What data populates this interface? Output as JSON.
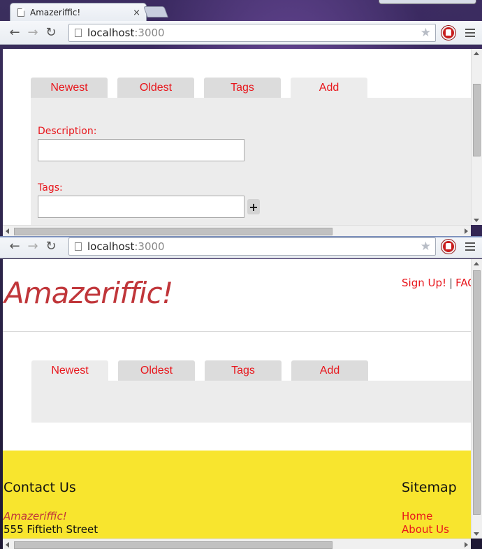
{
  "browser": {
    "tab_title": "Amazeriffic!",
    "tab_close": "×",
    "url_host": "localhost",
    "url_port": ":3000",
    "back_glyph": "←",
    "forward_glyph": "→",
    "reload_glyph": "↻",
    "star_glyph": "★"
  },
  "tabs": [
    "Newest",
    "Oldest",
    "Tags",
    "Add"
  ],
  "add_form": {
    "description_label": "Description:",
    "description_value": "",
    "tags_label": "Tags:",
    "tags_value": "",
    "add_tag_button": "+"
  },
  "header": {
    "logo": "Amazeriffic!",
    "signup_link": "Sign Up!",
    "separator": "|",
    "faq_link": "FAQ"
  },
  "footer": {
    "contact_heading": "Contact Us",
    "company": "Amazeriffic!",
    "street": "555 Fiftieth Street",
    "sitemap_heading": "Sitemap",
    "links": [
      "Home",
      "About Us"
    ]
  },
  "colors": {
    "accent_red": "#e8161c",
    "logo_red": "#c0363a",
    "footer_yellow": "#f8e52e",
    "tab_gray": "#dcdcdc"
  }
}
